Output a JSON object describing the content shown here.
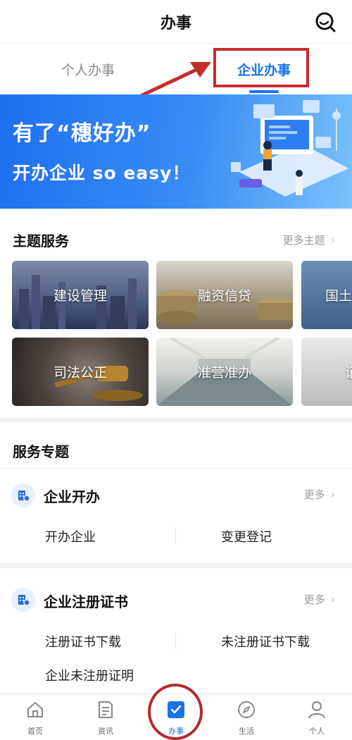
{
  "header": {
    "title": "办事"
  },
  "tabs": [
    {
      "label": "个人办事",
      "active": false
    },
    {
      "label": "企业办事",
      "active": true
    }
  ],
  "banner": {
    "line1": "有了“穗好办”",
    "line2": "开办企业 so easy！"
  },
  "theme_services": {
    "title": "主题服务",
    "more": "更多主题",
    "cards": [
      {
        "label": "建设管理"
      },
      {
        "label": "融资信贷"
      },
      {
        "label": "国土"
      },
      {
        "label": "司法公正"
      },
      {
        "label": "准营准办"
      },
      {
        "label": "证"
      }
    ]
  },
  "service_topics": {
    "title": "服务专题",
    "groups": [
      {
        "title": "企业开办",
        "more": "更多",
        "items": [
          "开办企业",
          "变更登记"
        ]
      },
      {
        "title": "企业注册证书",
        "more": "更多",
        "items": [
          "注册证书下载",
          "未注册证书下载",
          "企业未注册证明"
        ]
      }
    ]
  },
  "bottom_nav": [
    {
      "label": "首页",
      "icon": "home-icon"
    },
    {
      "label": "资讯",
      "icon": "news-icon"
    },
    {
      "label": "办事",
      "icon": "task-icon",
      "active": true
    },
    {
      "label": "生活",
      "icon": "compass-icon"
    },
    {
      "label": "个人",
      "icon": "person-icon"
    }
  ],
  "colors": {
    "accent": "#1a73e8",
    "annotation": "#c62d2d"
  }
}
